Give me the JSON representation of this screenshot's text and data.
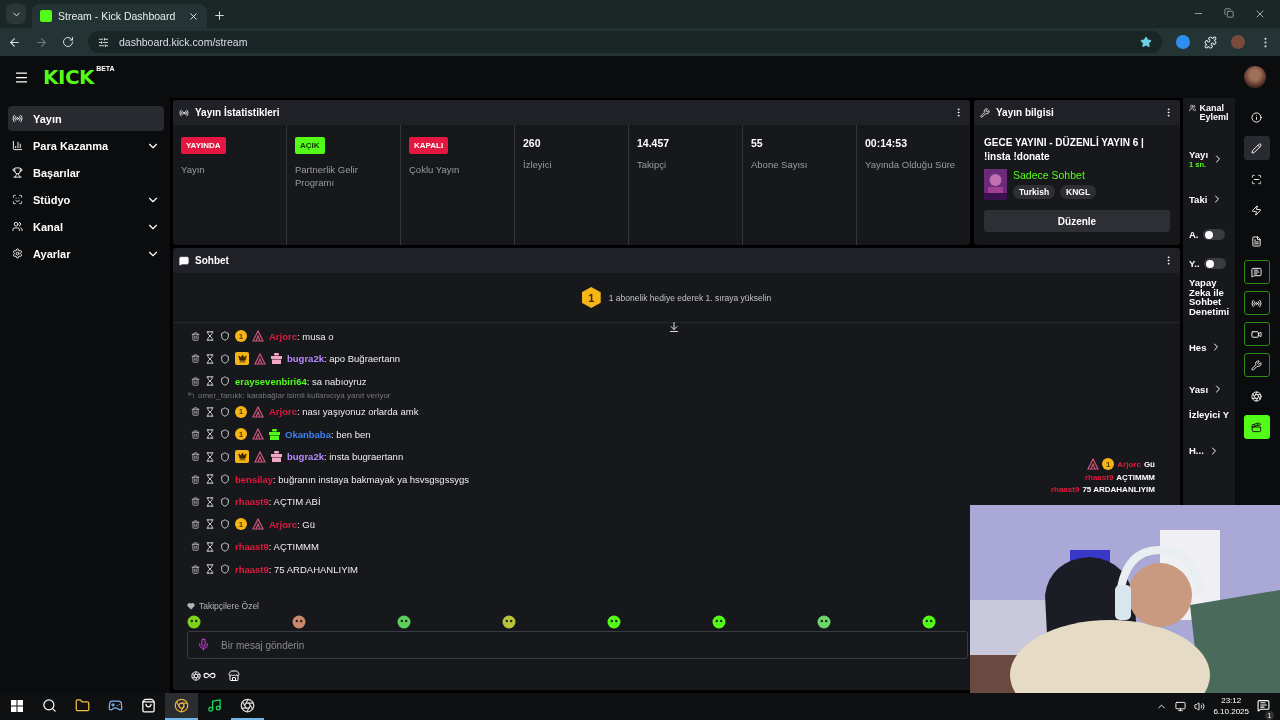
{
  "browser": {
    "tab_title": "Stream - Kick Dashboard",
    "url": "dashboard.kick.com/stream"
  },
  "header": {
    "logo": "KICK",
    "logo_badge": "BETA"
  },
  "sidebar": {
    "items": [
      {
        "label": "Yayın",
        "selected": true,
        "expandable": false
      },
      {
        "label": "Para Kazanma",
        "selected": false,
        "expandable": true
      },
      {
        "label": "Başarılar",
        "selected": false,
        "expandable": false
      },
      {
        "label": "Stüdyo",
        "selected": false,
        "expandable": true
      },
      {
        "label": "Kanal",
        "selected": false,
        "expandable": true
      },
      {
        "label": "Ayarlar",
        "selected": false,
        "expandable": true
      }
    ]
  },
  "stats": {
    "title": "Yayın İstatistikleri",
    "cells": [
      {
        "kind": "badge",
        "value": "YAYINDA",
        "color": "#e3173f",
        "label": "Yayın"
      },
      {
        "kind": "badge",
        "value": "AÇIK",
        "color": "#53fc18",
        "label": "Partnerlik Gelir Programı"
      },
      {
        "kind": "badge",
        "value": "KAPALI",
        "color": "#e3173f",
        "label": "Çoklu Yayın"
      },
      {
        "kind": "number",
        "value": "260",
        "label": "İzleyici"
      },
      {
        "kind": "number",
        "value": "14.457",
        "label": "Takipçi"
      },
      {
        "kind": "number",
        "value": "55",
        "label": "Abone Sayısı"
      },
      {
        "kind": "number",
        "value": "00:14:53",
        "label": "Yayında Olduğu Süre"
      }
    ]
  },
  "stream_info": {
    "title": "Yayın bilgisi",
    "stream_title": "GECE YAYINI - DÜZENLİ YAYIN 6 | !insta !donate",
    "category": "Sadece Sohbet",
    "tags": [
      "Turkish",
      "KNGL"
    ],
    "edit_button": "Düzenle"
  },
  "chat": {
    "title": "Sohbet",
    "gift_badge": "1",
    "gift_text": "1 abonelik hediye ederek 1. sıraya yükselin",
    "messages": [
      {
        "kind": "message",
        "user": "Arjorc",
        "color": "#e0193f",
        "text": ": musa o",
        "badges": [
          {
            "kind": "sub",
            "label": "1"
          },
          {
            "kind": "og"
          }
        ]
      },
      {
        "kind": "message",
        "user": "bugra2k",
        "color": "#b98bff",
        "text": ": apo Buğraertann",
        "badges": [
          {
            "kind": "crown"
          },
          {
            "kind": "og"
          },
          {
            "kind": "gift",
            "color": "#f2a7c6"
          }
        ]
      },
      {
        "kind": "message",
        "user": "eraysevenbiri64",
        "color": "#53fc18",
        "text": ": sa nabıoyruz"
      },
      {
        "kind": "reply",
        "text": "omer_farukk: karabağlar isimli kullanıcıya yanıt veriyor"
      },
      {
        "kind": "message",
        "user": "Arjorc",
        "color": "#e0193f",
        "text": ": nası yaşıyonuz orlarda amk",
        "badges": [
          {
            "kind": "sub",
            "label": "1"
          },
          {
            "kind": "og"
          }
        ]
      },
      {
        "kind": "message",
        "user": "Okanbaba",
        "color": "#3b82f6",
        "text": ": ben ben",
        "badges": [
          {
            "kind": "sub",
            "label": "1"
          },
          {
            "kind": "og"
          },
          {
            "kind": "gift",
            "color": "#53fc18"
          }
        ]
      },
      {
        "kind": "message",
        "user": "bugra2k",
        "color": "#b98bff",
        "text": ": insta bugraertann",
        "badges": [
          {
            "kind": "crown"
          },
          {
            "kind": "og"
          },
          {
            "kind": "gift",
            "color": "#f2a7c6"
          }
        ]
      },
      {
        "kind": "message",
        "user": "bensilay",
        "color": "#e0193f",
        "text": ": buğranın instaya bakmayak ya hsvsgsgssygs"
      },
      {
        "kind": "message",
        "user": "rhaast9",
        "color": "#e0193f",
        "text": ": AÇTIM ABİ"
      },
      {
        "kind": "message",
        "user": "Arjorc",
        "color": "#e0193f",
        "text": ": Gü",
        "badges": [
          {
            "kind": "sub",
            "label": "1"
          },
          {
            "kind": "og"
          }
        ]
      },
      {
        "kind": "message",
        "user": "rhaast9",
        "color": "#e0193f",
        "text": ": AÇTIMMM"
      },
      {
        "kind": "message",
        "user": "rhaast9",
        "color": "#e0193f",
        "text": ": 75 ARDAHANLIYIM"
      }
    ],
    "emote_section": "Takipçilere Özel",
    "input_placeholder": "Bir mesaj gönderin"
  },
  "stream_overlay": {
    "messages": [
      {
        "user": "Arjorc",
        "color": "#e0193f",
        "text": "Gü",
        "badges": [
          {
            "kind": "og"
          },
          {
            "kind": "sub",
            "label": "1"
          }
        ]
      },
      {
        "user": "rhaast9",
        "color": "#e0193f",
        "text": "AÇTIMMM"
      },
      {
        "user": "rhaast9",
        "color": "#e0193f",
        "text": "75 ARDAHANLIYIM"
      }
    ]
  },
  "channel_actions": {
    "title": "Kanal Eyleml",
    "items": [
      {
        "kind": "link",
        "label": "Yayı",
        "note": "1 sn."
      },
      {
        "kind": "link",
        "label": "Taki"
      },
      {
        "kind": "toggle",
        "label": "A.",
        "on": false
      },
      {
        "kind": "toggle",
        "label": "Y..",
        "on": false
      },
      {
        "kind": "text",
        "label": "Yapay Zeka ile Sohbet Denetimi"
      },
      {
        "kind": "link",
        "label": "Hes"
      },
      {
        "kind": "link",
        "label": "Yası"
      },
      {
        "kind": "text",
        "label": "İzleyici Y"
      },
      {
        "kind": "link",
        "label": "H..."
      }
    ]
  },
  "rail": {
    "items": [
      {
        "kind": "plain",
        "selected": false
      },
      {
        "kind": "plain",
        "selected": true
      },
      {
        "kind": "plain",
        "selected": false
      },
      {
        "kind": "plain",
        "selected": false
      },
      {
        "kind": "plain",
        "selected": false
      },
      {
        "kind": "pinned",
        "selected": false
      },
      {
        "kind": "pinned",
        "selected": false
      },
      {
        "kind": "pinned",
        "selected": false
      },
      {
        "kind": "pinned",
        "selected": false
      },
      {
        "kind": "plain",
        "selected": false
      },
      {
        "kind": "filled",
        "selected": false
      }
    ]
  },
  "taskbar": {
    "apps": [
      {
        "selected": false,
        "running": false
      },
      {
        "selected": false,
        "running": false
      },
      {
        "selected": false,
        "running": false
      },
      {
        "selected": true,
        "running": true
      },
      {
        "selected": false,
        "running": false
      },
      {
        "selected": false,
        "running": true
      }
    ],
    "time": "23:12",
    "date": "6.10.2025",
    "notifications": "1"
  }
}
